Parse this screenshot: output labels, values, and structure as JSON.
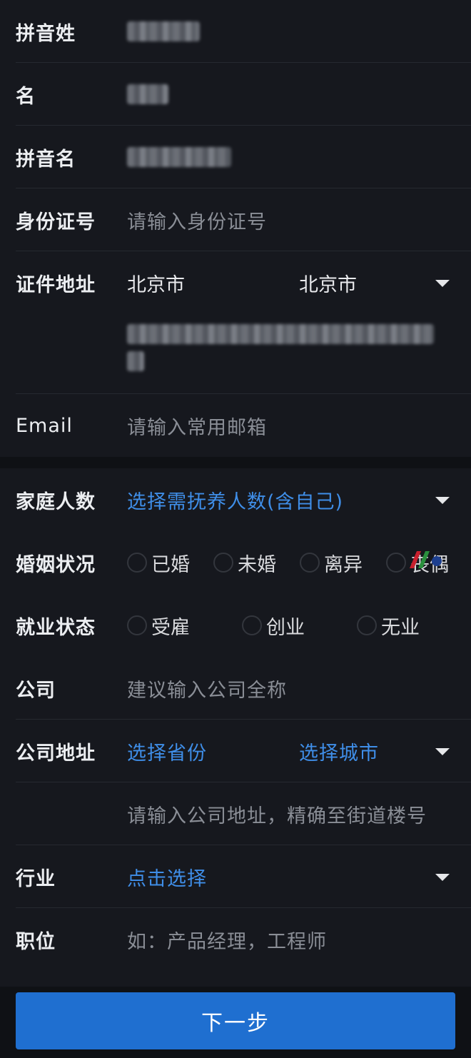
{
  "identity": {
    "pinyin_surname_label": "拼音姓",
    "given_name_label": "名",
    "pinyin_given_label": "拼音名",
    "id_number_label": "身份证号",
    "id_number_placeholder": "请输入身份证号",
    "id_address_label": "证件地址",
    "id_province": "北京市",
    "id_city": "北京市",
    "id_address_tail": "号",
    "email_label": "Email",
    "email_placeholder": "请输入常用邮箱"
  },
  "employment": {
    "family_label": "家庭人数",
    "family_select": "选择需抚养人数(含自己)",
    "marital_label": "婚姻状况",
    "marital_options": [
      "已婚",
      "未婚",
      "离异",
      "丧偶"
    ],
    "employment_label": "就业状态",
    "employment_options": [
      "受雇",
      "创业",
      "无业"
    ],
    "company_label": "公司",
    "company_placeholder": "建议输入公司全称",
    "company_address_label": "公司地址",
    "province_select": "选择省份",
    "city_select": "选择城市",
    "company_address_placeholder": "请输入公司地址，精确至街道楼号",
    "industry_label": "行业",
    "industry_select": "点击选择",
    "position_label": "职位",
    "position_placeholder": "如：产品经理，工程师"
  },
  "footer": {
    "next_label": "下一步"
  },
  "colors": {
    "accent": "#3f8ee8",
    "button": "#1f6fd0",
    "background": "#16181e"
  }
}
